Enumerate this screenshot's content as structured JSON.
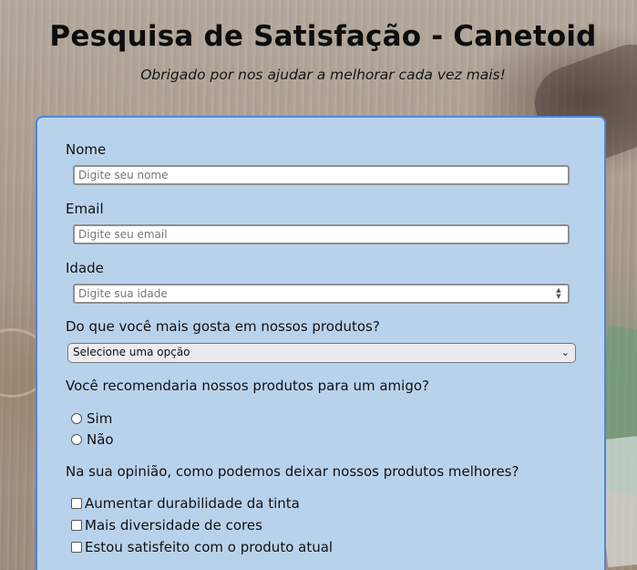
{
  "header": {
    "title": "Pesquisa de Satisfação - Canetoid",
    "subtitle": "Obrigado por nos ajudar a melhorar cada vez mais!"
  },
  "form": {
    "name": {
      "label": "Nome",
      "placeholder": "Digite seu nome",
      "value": ""
    },
    "email": {
      "label": "Email",
      "placeholder": "Digite seu email",
      "value": ""
    },
    "age": {
      "label": "Idade",
      "placeholder": "Digite sua idade",
      "value": ""
    },
    "favorite": {
      "label": "Do que você mais gosta em nossos produtos?",
      "selected": "Selecione uma opção"
    },
    "recommend": {
      "label": "Você recomendaria nossos produtos para um amigo?",
      "options": [
        "Sim",
        "Não"
      ]
    },
    "improve": {
      "label": "Na sua opinião, como podemos deixar nossos produtos melhores?",
      "options": [
        "Aumentar durabilidade da tinta",
        "Mais diversidade de cores",
        "Estou satisfeito com o produto atual"
      ]
    }
  },
  "colors": {
    "card_background": "#b9d2ec",
    "card_border": "#4f84dc"
  },
  "icons": {
    "select_arrow": "chevron-down-icon",
    "age_spinner": "spinner-arrows-icon"
  }
}
